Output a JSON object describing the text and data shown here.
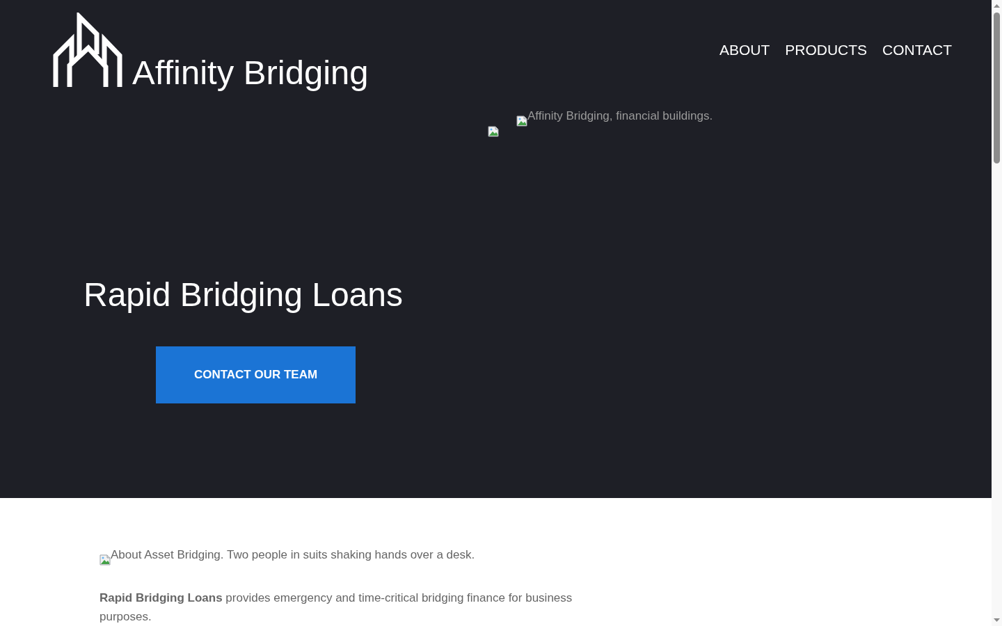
{
  "header": {
    "logo_text": "Affinity Bridging",
    "nav": [
      {
        "label": "ABOUT"
      },
      {
        "label": "PRODUCTS"
      },
      {
        "label": "CONTACT"
      }
    ]
  },
  "hero": {
    "image_alt": "Affinity Bridging, financial buildings.",
    "title": "Rapid Bridging Loans",
    "button": "CONTACT OUR TEAM"
  },
  "about": {
    "image_alt": "About Asset Bridging. Two people in suits shaking hands over a desk.",
    "paragraph": "**Rapid Bridging Loans** provides emergency and time-critical bridging finance for business purposes."
  }
}
